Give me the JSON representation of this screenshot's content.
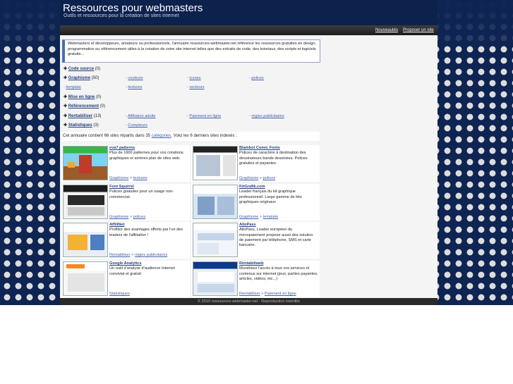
{
  "header": {
    "title": "Ressources pour webmasters",
    "subtitle": "Outils et ressources pour la création de sites internet"
  },
  "nav": {
    "news": "Nouveautés",
    "submit": "Proposer un site"
  },
  "intro": "Webmasters et développeurs, amateurs ou professionnels, l'annuaire ressources-webmaster.net référence les ressources gratuites en design, programmation ou référencement utiles à la création de votre site internet telles que des extraits de code, des tutoriaux, des scripts et logiciels gratuits...",
  "categories": [
    {
      "label": "Code source",
      "count": "(0)"
    },
    {
      "label": "Graphisme",
      "count": "(50)"
    },
    {
      "label": "Mise en ligne",
      "count": "(0)"
    },
    {
      "label": "Référencement",
      "count": "(0)"
    },
    {
      "label": "Rentabiliser",
      "count": "(13)"
    },
    {
      "label": "Statistiques",
      "count": "(3)"
    }
  ],
  "graphisme_subs": [
    "couleurs",
    "icones",
    "polices",
    "template",
    "textures",
    "vecteurs"
  ],
  "rentabiliser_subs": [
    "Affiliation adulte",
    "Paiement en ligne",
    "régies publicitaires"
  ],
  "statistiques_subs": [
    "Compteurs"
  ],
  "directory": {
    "before": "Cet annuaire contient 66 sites répartis dans 35",
    "link": "catégories",
    "after": ". Voici les 6 derniers sites indexés :"
  },
  "sites": [
    {
      "title": "eva7 patterns",
      "desc": "Plus de 1600 patternes pour vos créations graphiques et arrières plan de sites web.",
      "cat": "Graphisme",
      "sub": "textures"
    },
    {
      "title": "Blambot Comic Fonts",
      "desc": "Polices de caractère à destination des dessinateurs bande dessinées. Polices gratuites et payantes.",
      "cat": "Graphisme",
      "sub": "polices"
    },
    {
      "title": "Font Squirrel",
      "desc": "Polices gratuites pour un usage non-commercial.",
      "cat": "Graphisme",
      "sub": "polices"
    },
    {
      "title": "KitGrafik.com",
      "desc": "Leader français du kit graphique professionnel. Large gamme de kits graphiques originaux",
      "cat": "Graphisme",
      "sub": "template"
    },
    {
      "title": "AffiliNet",
      "desc": "Profitez des avantages offerts par l'un des leaders de l'affiliation !",
      "cat": "Rentabiliser",
      "sub": "régies publicitaires"
    },
    {
      "title": "AlloPass",
      "desc": "AlloPass, Leader européen du micropaiement propose aussi des solution de paiement par téléphone, SMS et carte bancaire.",
      "cat": "",
      "sub": ""
    },
    {
      "title": "Google Analytics",
      "desc": "Un outil d'analyse d'audience Internet convivial et gratuit",
      "cat": "Statistiques",
      "sub": ""
    },
    {
      "title": "Rentabiliweb",
      "desc": "Monétisez l'accès à tous vos services et contenus sur internet (jeux, parties payantes, articles, vidéos, etc...)",
      "cat": "Rentabiliser",
      "sub": "Paiement en ligne"
    }
  ],
  "footer": "© 2010 ressources-webmaster.net - Reproduction interdite"
}
